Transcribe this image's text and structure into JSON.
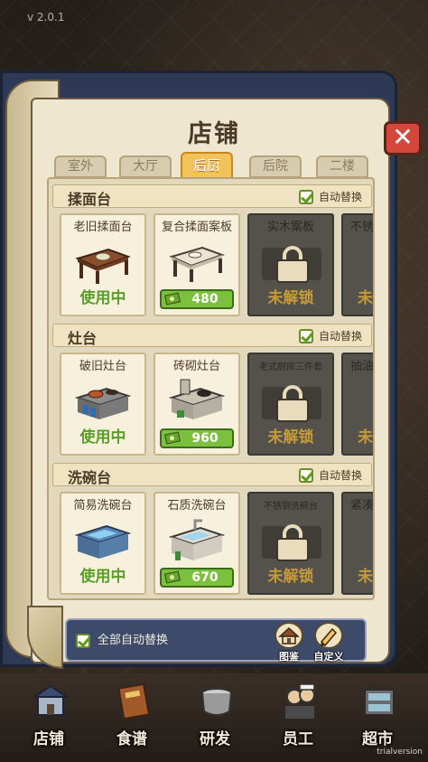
{
  "version": "v 2.0.1",
  "watermark": "trialversion",
  "dialog": {
    "title": "店铺",
    "close_icon": "close-icon",
    "tabs": [
      {
        "label": "室外",
        "active": false
      },
      {
        "label": "大厅",
        "active": false
      },
      {
        "label": "后厨",
        "active": true
      },
      {
        "label": "后院",
        "active": false
      },
      {
        "label": "二楼",
        "active": false
      }
    ],
    "auto_replace_label": "自动替换",
    "sections": [
      {
        "title": "揉面台",
        "cards": [
          {
            "name": "老旧揉面台",
            "status": "使用中",
            "locked": false
          },
          {
            "name": "复合揉面案板",
            "price": "480",
            "locked": false
          },
          {
            "name": "实木案板",
            "status": "未解锁",
            "locked": true
          },
          {
            "name": "不锈",
            "status": "未",
            "locked": true
          }
        ]
      },
      {
        "title": "灶台",
        "cards": [
          {
            "name": "破旧灶台",
            "status": "使用中",
            "locked": false
          },
          {
            "name": "砖砌灶台",
            "price": "960",
            "locked": false
          },
          {
            "name": "老式厨房三件套",
            "status": "未解锁",
            "locked": true
          },
          {
            "name": "抽油",
            "status": "未",
            "locked": true
          }
        ]
      },
      {
        "title": "洗碗台",
        "cards": [
          {
            "name": "简易洗碗台",
            "status": "使用中",
            "locked": false
          },
          {
            "name": "石质洗碗台",
            "price": "670",
            "locked": false
          },
          {
            "name": "不锈钢洗碗台",
            "status": "未解锁",
            "locked": true
          },
          {
            "name": "紧凑",
            "status": "未",
            "locked": true
          }
        ]
      }
    ],
    "all_auto_label": "全部自动替换",
    "handbook_label": "图鉴",
    "custom_label": "自定义"
  },
  "nav": [
    {
      "label": "店铺"
    },
    {
      "label": "食谱"
    },
    {
      "label": "研发"
    },
    {
      "label": "员工"
    },
    {
      "label": "超市"
    }
  ],
  "colors": {
    "active_tab": "#f2c35a",
    "in_use": "#5a9e2a",
    "locked_text": "#c59a3a",
    "price_button": "#7cc13e",
    "close_button": "#d4473a"
  }
}
